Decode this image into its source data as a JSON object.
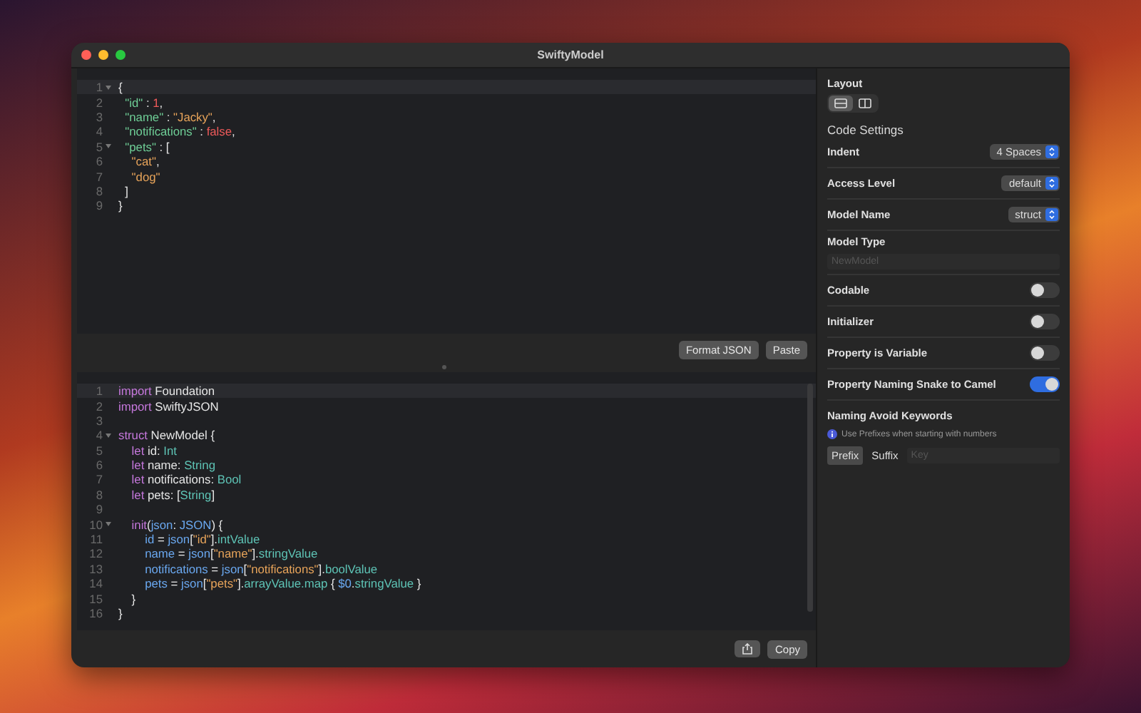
{
  "window": {
    "title": "SwiftyModel"
  },
  "json_editor": {
    "lines": [
      {
        "number": "1",
        "fold": true,
        "highlighted": true,
        "tokens": [
          {
            "text": "{",
            "kind": "plain"
          }
        ]
      },
      {
        "number": "2",
        "fold": false,
        "highlighted": false,
        "tokens": [
          {
            "text": "  \"id\"",
            "kind": "key"
          },
          {
            "text": " : ",
            "kind": "plain"
          },
          {
            "text": "1",
            "kind": "number"
          },
          {
            "text": ",",
            "kind": "plain"
          }
        ]
      },
      {
        "number": "3",
        "fold": false,
        "highlighted": false,
        "tokens": [
          {
            "text": "  \"name\"",
            "kind": "key"
          },
          {
            "text": " : ",
            "kind": "plain"
          },
          {
            "text": "\"Jacky\"",
            "kind": "string"
          },
          {
            "text": ",",
            "kind": "plain"
          }
        ]
      },
      {
        "number": "4",
        "fold": false,
        "highlighted": false,
        "tokens": [
          {
            "text": "  \"notifications\"",
            "kind": "key"
          },
          {
            "text": " : ",
            "kind": "plain"
          },
          {
            "text": "false",
            "kind": "number"
          },
          {
            "text": ",",
            "kind": "plain"
          }
        ]
      },
      {
        "number": "5",
        "fold": true,
        "highlighted": false,
        "tokens": [
          {
            "text": "  \"pets\"",
            "kind": "key"
          },
          {
            "text": " : [",
            "kind": "plain"
          }
        ]
      },
      {
        "number": "6",
        "fold": false,
        "highlighted": false,
        "tokens": [
          {
            "text": "    \"cat\"",
            "kind": "string"
          },
          {
            "text": ",",
            "kind": "plain"
          }
        ]
      },
      {
        "number": "7",
        "fold": false,
        "highlighted": false,
        "tokens": [
          {
            "text": "    \"dog\"",
            "kind": "string"
          }
        ]
      },
      {
        "number": "8",
        "fold": false,
        "highlighted": false,
        "tokens": [
          {
            "text": "  ]",
            "kind": "plain"
          }
        ]
      },
      {
        "number": "9",
        "fold": false,
        "highlighted": false,
        "tokens": [
          {
            "text": "}",
            "kind": "plain"
          }
        ]
      }
    ],
    "buttons": [
      "Format JSON",
      "Paste"
    ]
  },
  "code_editor": {
    "lines": [
      {
        "number": "1",
        "fold": false,
        "highlighted": true,
        "tokens": [
          {
            "text": "import",
            "kind": "keyword"
          },
          {
            "text": " Foundation",
            "kind": "plain"
          }
        ]
      },
      {
        "number": "2",
        "fold": false,
        "highlighted": false,
        "tokens": [
          {
            "text": "import",
            "kind": "keyword"
          },
          {
            "text": " SwiftyJSON",
            "kind": "plain"
          }
        ]
      },
      {
        "number": "3",
        "fold": false,
        "highlighted": false
      },
      {
        "number": "4",
        "fold": true,
        "highlighted": false,
        "tokens": [
          {
            "text": "struct",
            "kind": "keyword"
          },
          {
            "text": " NewModel {",
            "kind": "plain"
          }
        ]
      },
      {
        "number": "5",
        "fold": false,
        "highlighted": false,
        "tokens": [
          {
            "text": "    let",
            "kind": "keyword"
          },
          {
            "text": " id: ",
            "kind": "plain"
          },
          {
            "text": "Int",
            "kind": "type"
          }
        ]
      },
      {
        "number": "6",
        "fold": false,
        "highlighted": false,
        "tokens": [
          {
            "text": "    let",
            "kind": "keyword"
          },
          {
            "text": " name: ",
            "kind": "plain"
          },
          {
            "text": "String",
            "kind": "type"
          }
        ]
      },
      {
        "number": "7",
        "fold": false,
        "highlighted": false,
        "tokens": [
          {
            "text": "    let",
            "kind": "keyword"
          },
          {
            "text": " notifications: ",
            "kind": "plain"
          },
          {
            "text": "Bool",
            "kind": "type"
          }
        ]
      },
      {
        "number": "8",
        "fold": false,
        "highlighted": false,
        "tokens": [
          {
            "text": "    let",
            "kind": "keyword"
          },
          {
            "text": " pets: [",
            "kind": "plain"
          },
          {
            "text": "String",
            "kind": "type"
          },
          {
            "text": "]",
            "kind": "plain"
          }
        ]
      },
      {
        "number": "9",
        "fold": false,
        "highlighted": false
      },
      {
        "number": "10",
        "fold": true,
        "highlighted": false,
        "tokens": [
          {
            "text": "    init",
            "kind": "keyword"
          },
          {
            "text": "(",
            "kind": "plain"
          },
          {
            "text": "json",
            "kind": "ident"
          },
          {
            "text": ": ",
            "kind": "plain"
          },
          {
            "text": "JSON",
            "kind": "ident"
          },
          {
            "text": ") {",
            "kind": "plain"
          }
        ]
      },
      {
        "number": "11",
        "fold": false,
        "highlighted": false,
        "tokens": [
          {
            "text": "        id",
            "kind": "ident"
          },
          {
            "text": " = ",
            "kind": "plain"
          },
          {
            "text": "json",
            "kind": "ident"
          },
          {
            "text": "[",
            "kind": "plain"
          },
          {
            "text": "\"id\"",
            "kind": "string"
          },
          {
            "text": "].",
            "kind": "plain"
          },
          {
            "text": "intValue",
            "kind": "type"
          }
        ]
      },
      {
        "number": "12",
        "fold": false,
        "highlighted": false,
        "tokens": [
          {
            "text": "        name",
            "kind": "ident"
          },
          {
            "text": " = ",
            "kind": "plain"
          },
          {
            "text": "json",
            "kind": "ident"
          },
          {
            "text": "[",
            "kind": "plain"
          },
          {
            "text": "\"name\"",
            "kind": "string"
          },
          {
            "text": "].",
            "kind": "plain"
          },
          {
            "text": "stringValue",
            "kind": "type"
          }
        ]
      },
      {
        "number": "13",
        "fold": false,
        "highlighted": false,
        "tokens": [
          {
            "text": "        notifications",
            "kind": "ident"
          },
          {
            "text": " = ",
            "kind": "plain"
          },
          {
            "text": "json",
            "kind": "ident"
          },
          {
            "text": "[",
            "kind": "plain"
          },
          {
            "text": "\"notifications\"",
            "kind": "string"
          },
          {
            "text": "].",
            "kind": "plain"
          },
          {
            "text": "boolValue",
            "kind": "type"
          }
        ]
      },
      {
        "number": "14",
        "fold": false,
        "highlighted": false,
        "tokens": [
          {
            "text": "        pets",
            "kind": "ident"
          },
          {
            "text": " = ",
            "kind": "plain"
          },
          {
            "text": "json",
            "kind": "ident"
          },
          {
            "text": "[",
            "kind": "plain"
          },
          {
            "text": "\"pets\"",
            "kind": "string"
          },
          {
            "text": "].",
            "kind": "plain"
          },
          {
            "text": "arrayValue.map",
            "kind": "type"
          },
          {
            "text": " { ",
            "kind": "plain"
          },
          {
            "text": "$0",
            "kind": "ident"
          },
          {
            "text": ".",
            "kind": "plain"
          },
          {
            "text": "stringValue",
            "kind": "type"
          },
          {
            "text": " }",
            "kind": "plain"
          }
        ]
      },
      {
        "number": "15",
        "fold": false,
        "highlighted": false,
        "tokens": [
          {
            "text": "    }",
            "kind": "plain"
          }
        ]
      },
      {
        "number": "16",
        "fold": false,
        "highlighted": false,
        "tokens": [
          {
            "text": "}",
            "kind": "plain"
          }
        ]
      }
    ],
    "buttons": [
      "Copy"
    ]
  },
  "settings": {
    "layout_title": "Layout",
    "layout_options": [
      {
        "kind": "stacked",
        "selected": true
      },
      {
        "kind": "side",
        "selected": false
      }
    ],
    "section_title": "Code Settings",
    "rows": [
      {
        "kind": "select",
        "label": "Indent",
        "value": "4 Spaces"
      },
      {
        "kind": "select",
        "label": "Access Level",
        "value": "default"
      },
      {
        "kind": "select",
        "label": "Model Name",
        "value": "struct"
      },
      {
        "kind": "text",
        "label": "Model Type",
        "placeholder": "NewModel"
      },
      {
        "kind": "toggle",
        "label": "Codable",
        "on": false
      },
      {
        "kind": "toggle",
        "label": "Initializer",
        "on": false
      },
      {
        "kind": "toggle",
        "label": "Property is Variable",
        "on": false
      },
      {
        "kind": "toggle",
        "label": "Property Naming Snake to Camel",
        "on": true
      }
    ],
    "keywords": {
      "title": "Naming Avoid Keywords",
      "hint": "Use Prefixes when starting with numbers",
      "options": [
        {
          "label": "Prefix",
          "selected": true
        },
        {
          "label": "Suffix",
          "selected": false
        }
      ],
      "placeholder": "Key"
    }
  }
}
